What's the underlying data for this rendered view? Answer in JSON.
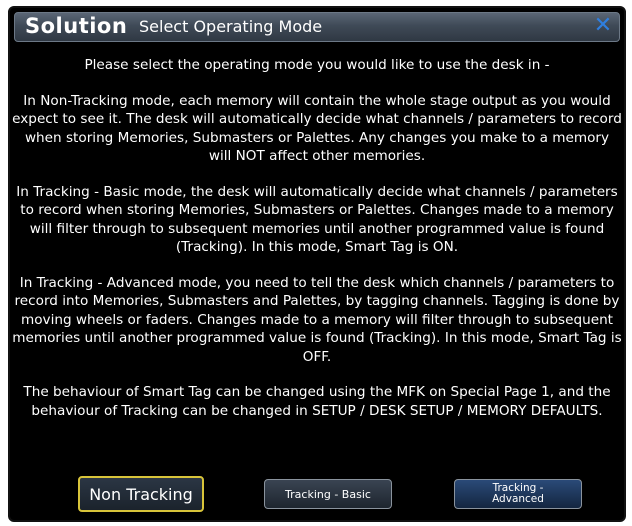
{
  "window": {
    "brand": "Solution",
    "title": "Select Operating Mode",
    "close_glyph": "✕"
  },
  "content": {
    "intro": "Please select the operating mode you would like to use the desk in -",
    "non_tracking": "In Non-Tracking mode, each memory will contain the whole stage output as you would expect to see it.  The desk will automatically decide what channels / parameters to record when storing Memories, Submasters or Palettes.  Any changes you make to a memory will NOT affect other memories.",
    "tracking_basic": "In Tracking - Basic mode, the desk will automatically decide what channels / parameters to record when storing Memories, Submasters or Palettes. Changes made to a memory will filter through to subsequent memories until another programmed value is found (Tracking).  In this mode, Smart Tag is ON.",
    "tracking_advanced": "In Tracking - Advanced mode, you need to tell the desk which channels / parameters to record into Memories, Submasters and Palettes, by tagging channels.  Tagging is done by moving wheels or faders.  Changes made to a memory will filter through to subsequent memories until another programmed value is found (Tracking).  In this mode, Smart Tag is OFF.",
    "footer": "The behaviour of Smart Tag can be changed using the MFK on Special Page 1, and the behaviour of Tracking can be changed in SETUP / DESK SETUP / MEMORY DEFAULTS."
  },
  "buttons": {
    "non_tracking": "Non Tracking",
    "tracking_basic": "Tracking - Basic",
    "tracking_advanced_line1": "Tracking -",
    "tracking_advanced_line2": "Advanced"
  },
  "colors": {
    "background": "#000000",
    "titlebar": "#3f4a57",
    "close_icon": "#2f7fe0",
    "selected_border": "#d8c43a",
    "advanced_button": "#2a4a78"
  },
  "icons": {
    "close": "close-icon"
  }
}
